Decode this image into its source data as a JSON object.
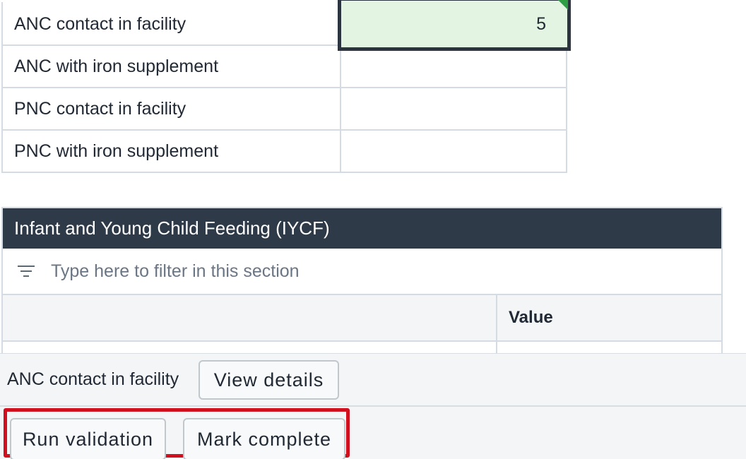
{
  "data_entry": {
    "rows": [
      {
        "label": "ANC contact in facility",
        "value": "5",
        "active": true
      },
      {
        "label": "ANC with iron supplement",
        "value": ""
      },
      {
        "label": "PNC contact in facility",
        "value": ""
      },
      {
        "label": "PNC with iron supplement",
        "value": ""
      }
    ]
  },
  "section": {
    "title": "Infant and Young Child Feeding (IYCF)",
    "filter_placeholder": "Type here to filter in this section",
    "value_column_header": "Value"
  },
  "bottom_bar": {
    "selected_field_label": "ANC contact in facility",
    "view_details_label": "View details",
    "run_validation_label": "Run validation",
    "mark_complete_label": "Mark complete"
  },
  "colors": {
    "section_header_bg": "#2e3a48",
    "active_cell_bg": "#e3f4e3",
    "active_cell_border": "#2c3440",
    "highlight_frame": "#d0101f",
    "saved_flag": "#2e9e44"
  },
  "icons": {
    "filter": "filter-lines-icon",
    "saved": "saved-corner-flag-icon"
  }
}
